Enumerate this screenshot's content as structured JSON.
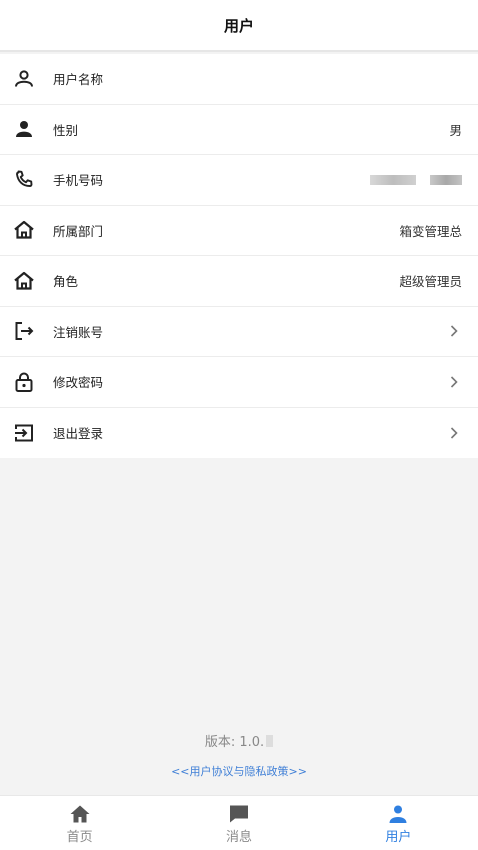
{
  "header": {
    "title": "用户"
  },
  "rows": [
    {
      "label": "用户名称",
      "value": "",
      "icon": "user-outline-icon"
    },
    {
      "label": "性别",
      "value": "男",
      "icon": "person-icon"
    },
    {
      "label": "手机号码",
      "value": "",
      "icon": "phone-icon"
    },
    {
      "label": "所属部门",
      "value": "箱变管理总",
      "icon": "home-icon"
    },
    {
      "label": "角色",
      "value": "超级管理员",
      "icon": "home-icon"
    },
    {
      "label": "注销账号",
      "value": "",
      "icon": "logout-icon"
    },
    {
      "label": "修改密码",
      "value": "",
      "icon": "lock-icon"
    },
    {
      "label": "退出登录",
      "value": "",
      "icon": "exit-icon"
    }
  ],
  "footer": {
    "version": "版本: 1.0.",
    "policy": "<<用户协议与隐私政策>>"
  },
  "tabbar": {
    "items": [
      {
        "label": "首页",
        "icon": "home-filled-icon"
      },
      {
        "label": "消息",
        "icon": "message-icon"
      },
      {
        "label": "用户",
        "icon": "user-filled-icon"
      }
    ],
    "active_color": "#2f7fe0",
    "inactive_color": "#8a8a8a"
  }
}
